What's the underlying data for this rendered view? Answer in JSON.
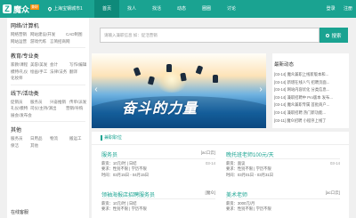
{
  "header": {
    "logo_mark": "Z",
    "logo_text": "魔众",
    "logo_badge": "兼职",
    "city": "上海宝钢城市1",
    "nav": [
      "首页",
      "找人",
      "找活",
      "动态",
      "圈圈",
      "讨论"
    ],
    "login": "登录",
    "register": "注册"
  },
  "sidebar": {
    "categories": [
      {
        "title": "网络/计算机",
        "links": [
          "网络营销",
          "网站建设/开发",
          "CAD制图",
          "网站运营",
          "游戏代练",
          "言简招商网"
        ]
      },
      {
        "title": "教育/专业类",
        "links": [
          "家教/课程",
          "美容/美发",
          "会计",
          "写作/编辑",
          "模特/礼仪",
          "绘画/手工",
          "法律/法务",
          "翻译",
          "化妆师"
        ]
      },
      {
        "title": "线下/活动类",
        "links": [
          "促销员",
          "服务员",
          "兴奋推销",
          "传单/派发",
          "礼仪/模特",
          "司仪/主持/演出",
          "营销/导购",
          "展会/发布会"
        ]
      },
      {
        "title": "其他",
        "links": [
          "服务员",
          "日用品",
          "物流",
          "搬运工",
          "保洁",
          "其他"
        ]
      }
    ],
    "bottom_label": "在线客服"
  },
  "search": {
    "placeholder": "请输入兼职信息 如：促活营销",
    "button": "搜索"
  },
  "banner": {
    "title": "奋斗的力量",
    "prev": "‹",
    "next": "›"
  },
  "news": {
    "title": "最新动态",
    "items": [
      "[03-14] 魔众兼职上线新版本和...",
      "[03-14] 新增在线人气 招聘页面...",
      "[03-14] 网站内容优化 分类信息...",
      "[03-14] 兼职招聘中 Pro版本 发布...",
      "[03-14] 魔众兼职专属 首批商户...",
      "[03-14] 兼职招聘 热门新功能...",
      "[03-11] 魔众招聘 小程序上线了"
    ]
  },
  "jobs": {
    "section_title": "兼职职位",
    "items": [
      {
        "title": "服务员",
        "company": "[ac口云]",
        "pay": "薪资：10元/时 | 日结",
        "req": "要求：性别不限 | 学历不限",
        "time": "时间：03月15日 - 04月15日",
        "date": "03-14"
      },
      {
        "title": "晚托班老师100元/天",
        "company": "",
        "pay": "薪资：面议",
        "req": "要求：性别不限 | 学历不限",
        "time": "时间：03月01日 - 03月31日",
        "date": "03-14"
      },
      {
        "title": "领袖海报店招聘服务员",
        "company": "[魔众]",
        "pay": "薪资：10元/时 | 日结",
        "req": "要求：性别不限 | 学历不限",
        "time": "",
        "date": ""
      },
      {
        "title": "美术老师",
        "company": "[ac口云]",
        "pay": "薪资：3000元/月",
        "req": "要求：性别不限 | 学历不限",
        "time": "",
        "date": ""
      }
    ]
  },
  "colors": {
    "accent": "#1aa391",
    "accent_dark": "#0e8a7a"
  }
}
